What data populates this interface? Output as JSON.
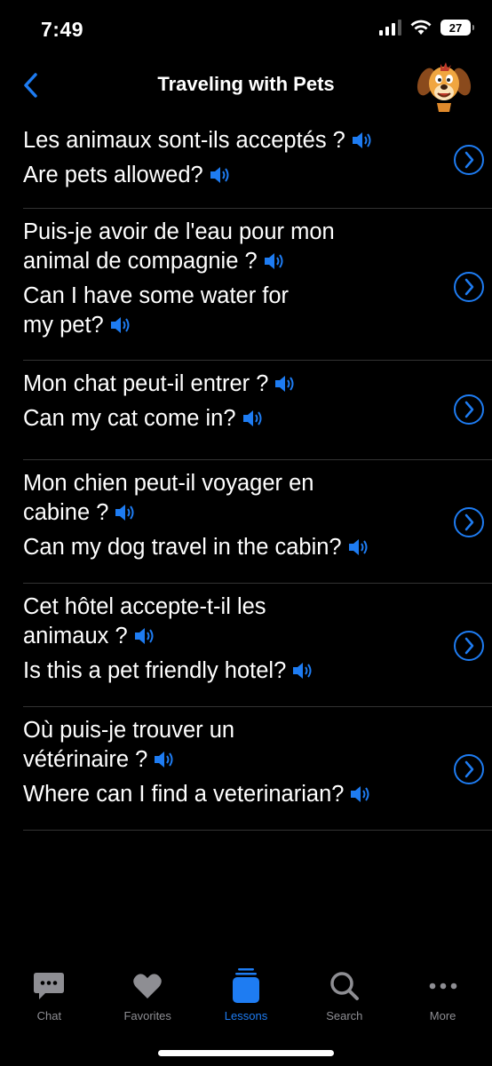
{
  "status_bar": {
    "time": "7:49",
    "battery": "27"
  },
  "nav": {
    "title": "Traveling with Pets",
    "accent": "#1e7cf2"
  },
  "phrases": [
    {
      "french": "Les animaux sont-ils acceptés ?",
      "english": "Are pets allowed?"
    },
    {
      "french": "Puis-je avoir de l'eau pour mon animal de compagnie ?",
      "english": "Can I have some water for my pet?"
    },
    {
      "french": "Mon chat peut-il entrer ?",
      "english": "Can my cat come in?"
    },
    {
      "french": "Mon chien peut-il voyager en cabine ?",
      "english": "Can my dog travel in the cabin?"
    },
    {
      "french": "Cet hôtel accepte-t-il les animaux ?",
      "english": "Is this a pet friendly hotel?"
    },
    {
      "french": "Où puis-je trouver un vétérinaire ?",
      "english": "Where can I find a veterinarian?"
    }
  ],
  "tabs": [
    {
      "label": "Chat",
      "icon": "chat-bubble-icon",
      "active": false
    },
    {
      "label": "Favorites",
      "icon": "heart-icon",
      "active": false
    },
    {
      "label": "Lessons",
      "icon": "lessons-stack-icon",
      "active": true
    },
    {
      "label": "Search",
      "icon": "search-icon",
      "active": false
    },
    {
      "label": "More",
      "icon": "more-dots-icon",
      "active": false
    }
  ]
}
